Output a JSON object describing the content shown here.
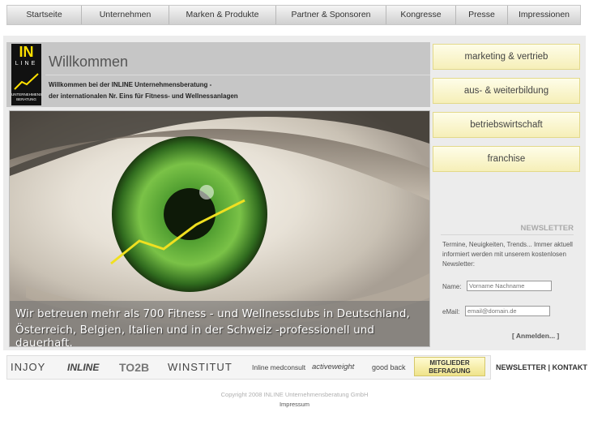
{
  "nav": {
    "items": [
      {
        "label": "Startseite"
      },
      {
        "label": "Unternehmen"
      },
      {
        "label": "Marken & Produkte"
      },
      {
        "label": "Partner & Sponsoren"
      },
      {
        "label": "Kongresse"
      },
      {
        "label": "Presse"
      },
      {
        "label": "Impressionen"
      }
    ]
  },
  "logo": {
    "main": "IN",
    "line": "LINE",
    "sub": "UNTERNEHMENS BERATUNG"
  },
  "header": {
    "title": "Willkommen",
    "line1": "Willkommen bei der INLINE Unternehmensberatung -",
    "line2": "der internationalen Nr. Eins für Fitness- und Wellnessanlagen"
  },
  "hero": {
    "caption_line1": "Wir betreuen mehr als 700 Fitness - und Wellnessclubs in Deutschland,",
    "caption_line2": "Österreich, Belgien, Italien und in der Schweiz -professionell und dauerhaft."
  },
  "sidebar": {
    "buttons": [
      {
        "label": "marketing & vertrieb"
      },
      {
        "label": "aus- & weiterbildung"
      },
      {
        "label": "betriebswirtschaft"
      },
      {
        "label": "franchise"
      }
    ]
  },
  "newsletter": {
    "title": "NEWSLETTER",
    "description": "Termine, Neuigkeiten, Trends... Immer aktuell informiert werden mit unserem kostenlosen Newsletter:",
    "name_label": "Name:",
    "name_placeholder": "Vorname Nachname",
    "email_label": "eMail:",
    "email_placeholder": "email@domain.de",
    "submit": "[    Anmelden...   ]"
  },
  "partners": {
    "logos": [
      "INJOY",
      "INLINE",
      "TO2B",
      "WINSTITUT",
      "Inline medconsult",
      "activeweight",
      "good back"
    ],
    "befragung": "MITGLIEDER BEFRAGUNG"
  },
  "footer": {
    "newsletter_link": "NEWSLETTER",
    "separator": "|",
    "kontakt_link": "KONTAKT",
    "copyright": "Copyright 2008 INLINE Unternehmensberatung GmbH",
    "impressum": "Impressum"
  },
  "colors": {
    "accent_yellow": "#ffe000",
    "sidebar_button": "#f6efb8",
    "eye_green": "#3f8e2a"
  }
}
